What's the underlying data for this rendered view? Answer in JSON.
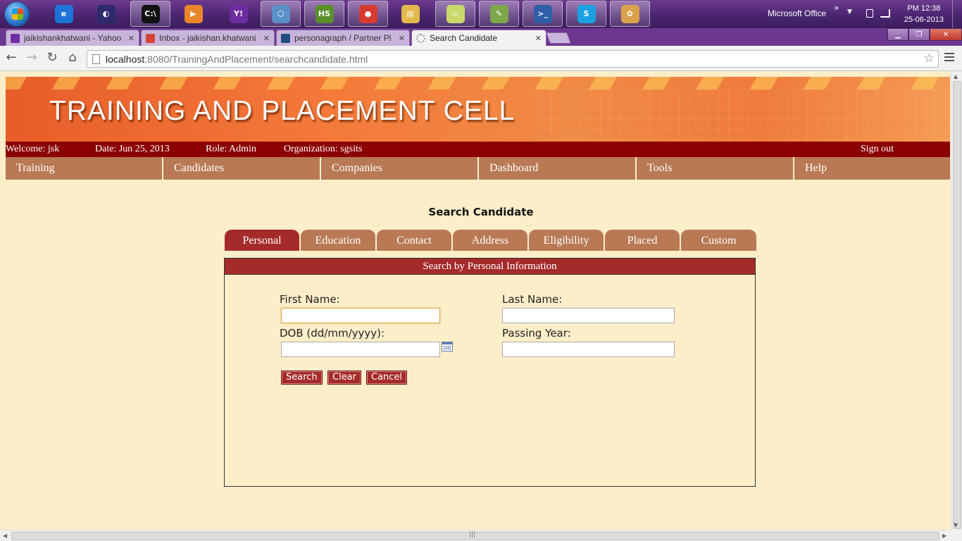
{
  "taskbar": {
    "apps": [
      {
        "icon": "internet-explorer-icon",
        "glyph": "e",
        "color": "#1e73d6",
        "open": false
      },
      {
        "icon": "eclipse-icon",
        "glyph": "◐",
        "color": "#2c2a6d",
        "open": false
      },
      {
        "icon": "command-prompt-icon",
        "glyph": "C:\\",
        "color": "#111111",
        "open": true
      },
      {
        "icon": "media-player-icon",
        "glyph": "▶",
        "color": "#e8862a",
        "open": false
      },
      {
        "icon": "yahoo-messenger-icon",
        "glyph": "Y!",
        "color": "#6e2da0",
        "open": false
      },
      {
        "icon": "virtualbox-icon",
        "glyph": "⬡",
        "color": "#5b8fc7",
        "open": true
      },
      {
        "icon": "hotspot-shield-icon",
        "glyph": "HS",
        "color": "#5a8f2a",
        "open": true
      },
      {
        "icon": "chrome-icon",
        "glyph": "●",
        "color": "#d63b2f",
        "open": true
      },
      {
        "icon": "file-explorer-icon",
        "glyph": "▤",
        "color": "#e2b94a",
        "open": false
      },
      {
        "icon": "sticky-notes-icon",
        "glyph": "▱",
        "color": "#c9d96a",
        "open": true
      },
      {
        "icon": "notepad-plus-icon",
        "glyph": "✎",
        "color": "#7da84a",
        "open": true
      },
      {
        "icon": "powershell-icon",
        "glyph": ">_",
        "color": "#2f5fa8",
        "open": true
      },
      {
        "icon": "skype-icon",
        "glyph": "S",
        "color": "#1ba1e2",
        "open": true
      },
      {
        "icon": "paint-icon",
        "glyph": "✿",
        "color": "#d9a24a",
        "open": true
      }
    ],
    "tray_label": "Microsoft Office",
    "chevron": "»",
    "time": "PM 12:38",
    "date": "25-06-2013"
  },
  "browser": {
    "tabs": [
      {
        "title": "jaikishankhatwani - Yahoo",
        "favicon": "yahoo-mail-icon",
        "color": "#6e2da0"
      },
      {
        "title": "Inbox - jaikishan.khatwani",
        "favicon": "gmail-icon",
        "color": "#d44638"
      },
      {
        "title": "personagraph / Partner Pl",
        "favicon": "bitbucket-icon",
        "color": "#205081"
      },
      {
        "title": "Search Candidate",
        "favicon": "loading-icon",
        "color": "#999999"
      }
    ],
    "url_host": "localhost",
    "url_rest": ":8080/TrainingAndPlacement/searchcandidate.html"
  },
  "page": {
    "banner_title": "TRAINING AND PLACEMENT CELL",
    "welcome": "Welcome: jsk",
    "date": "Date: Jun 25, 2013",
    "role": "Role: Admin",
    "organization": "Organization: sgsits",
    "sign_out": "Sign out",
    "nav": [
      "Training",
      "Candidates",
      "Companies",
      "Dashboard",
      "Tools",
      "Help"
    ],
    "heading": "Search Candidate",
    "search_tabs": [
      "Personal",
      "Education",
      "Contact",
      "Address",
      "Eligibility",
      "Placed",
      "Custom"
    ],
    "active_tab": "Personal",
    "panel_title": "Search by Personal Information",
    "form": {
      "first_name_label": "First Name:",
      "first_name_value": "",
      "last_name_label": "Last Name:",
      "last_name_value": "",
      "dob_label": "DOB (dd/mm/yyyy):",
      "dob_value": "",
      "passing_year_label": "Passing Year:",
      "passing_year_value": ""
    },
    "buttons": {
      "search": "Search",
      "clear": "Clear",
      "cancel": "Cancel"
    },
    "colors": {
      "banner": "#f47a3a",
      "infobar": "#8b0000",
      "nav": "#b87954",
      "accent": "#a52a2a",
      "background": "#fdeeca"
    }
  }
}
